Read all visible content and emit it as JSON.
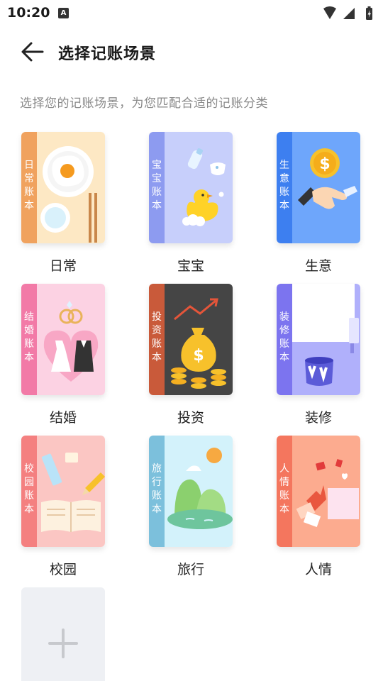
{
  "status": {
    "time": "10:20",
    "notification_glyph": "A"
  },
  "header": {
    "title": "选择记账场景"
  },
  "subtitle": "选择您的记账场景，为您匹配合适的记账分类",
  "books": [
    {
      "label": "日常",
      "spine": "日常账本",
      "spine_color": "#f0a25e",
      "cover_color": "#fde8c4",
      "art": "daily-icon"
    },
    {
      "label": "宝宝",
      "spine": "宝宝账本",
      "spine_color": "#8d9bf0",
      "cover_color": "#c7cffb",
      "art": "baby-icon"
    },
    {
      "label": "生意",
      "spine": "生意账本",
      "spine_color": "#3d7ff0",
      "cover_color": "#6ea6fb",
      "art": "business-icon"
    },
    {
      "label": "结婚",
      "spine": "结婚账本",
      "spine_color": "#f27aa7",
      "cover_color": "#fcd2e3",
      "art": "wedding-icon"
    },
    {
      "label": "投资",
      "spine": "投资账本",
      "spine_color": "#c95a3a",
      "cover_color": "#454545",
      "art": "investment-icon"
    },
    {
      "label": "装修",
      "spine": "装修账本",
      "spine_color": "#7c74ef",
      "cover_color": "#b0b0fb",
      "art": "renovation-icon"
    },
    {
      "label": "校园",
      "spine": "校园账本",
      "spine_color": "#f48080",
      "cover_color": "#fbc6c3",
      "art": "campus-icon"
    },
    {
      "label": "旅行",
      "spine": "旅行账本",
      "spine_color": "#7cc0dc",
      "cover_color": "#d3f2fb",
      "art": "travel-icon"
    },
    {
      "label": "人情",
      "spine": "人情账本",
      "spine_color": "#f4765e",
      "cover_color": "#fcab8f",
      "art": "gift-icon"
    }
  ],
  "add_tile": {
    "icon": "plus-icon"
  }
}
